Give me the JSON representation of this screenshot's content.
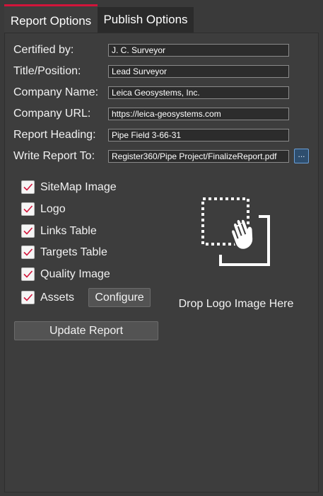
{
  "tabs": [
    {
      "label": "Report Options",
      "active": true
    },
    {
      "label": "Publish Options",
      "active": false
    }
  ],
  "form": {
    "certified_by": {
      "label": "Certified by:",
      "value": "J. C. Surveyor"
    },
    "title_position": {
      "label": "Title/Position:",
      "value": "Lead Surveyor"
    },
    "company_name": {
      "label": "Company Name:",
      "value": "Leica Geosystems, Inc."
    },
    "company_url": {
      "label": "Company URL:",
      "value": "https://leica-geosystems.com"
    },
    "report_heading": {
      "label": "Report Heading:",
      "value": "Pipe Field 3-66-31"
    },
    "write_report_to": {
      "label": "Write Report To:",
      "value": "Register360/Pipe Project/FinalizeReport.pdf",
      "browse_label": "..."
    }
  },
  "checkboxes": [
    {
      "label": "SiteMap Image",
      "checked": true
    },
    {
      "label": "Logo",
      "checked": true
    },
    {
      "label": "Links Table",
      "checked": true
    },
    {
      "label": "Targets Table",
      "checked": true
    },
    {
      "label": "Quality Image",
      "checked": true
    },
    {
      "label": "Assets",
      "checked": true
    }
  ],
  "buttons": {
    "configure": "Configure",
    "update_report": "Update Report"
  },
  "logo_drop": {
    "text": "Drop Logo Image Here",
    "icon": "drag-drop-hand-icon"
  },
  "colors": {
    "accent": "#d2143a",
    "background": "#3d3d3d",
    "checkmark": "#d2143a"
  }
}
